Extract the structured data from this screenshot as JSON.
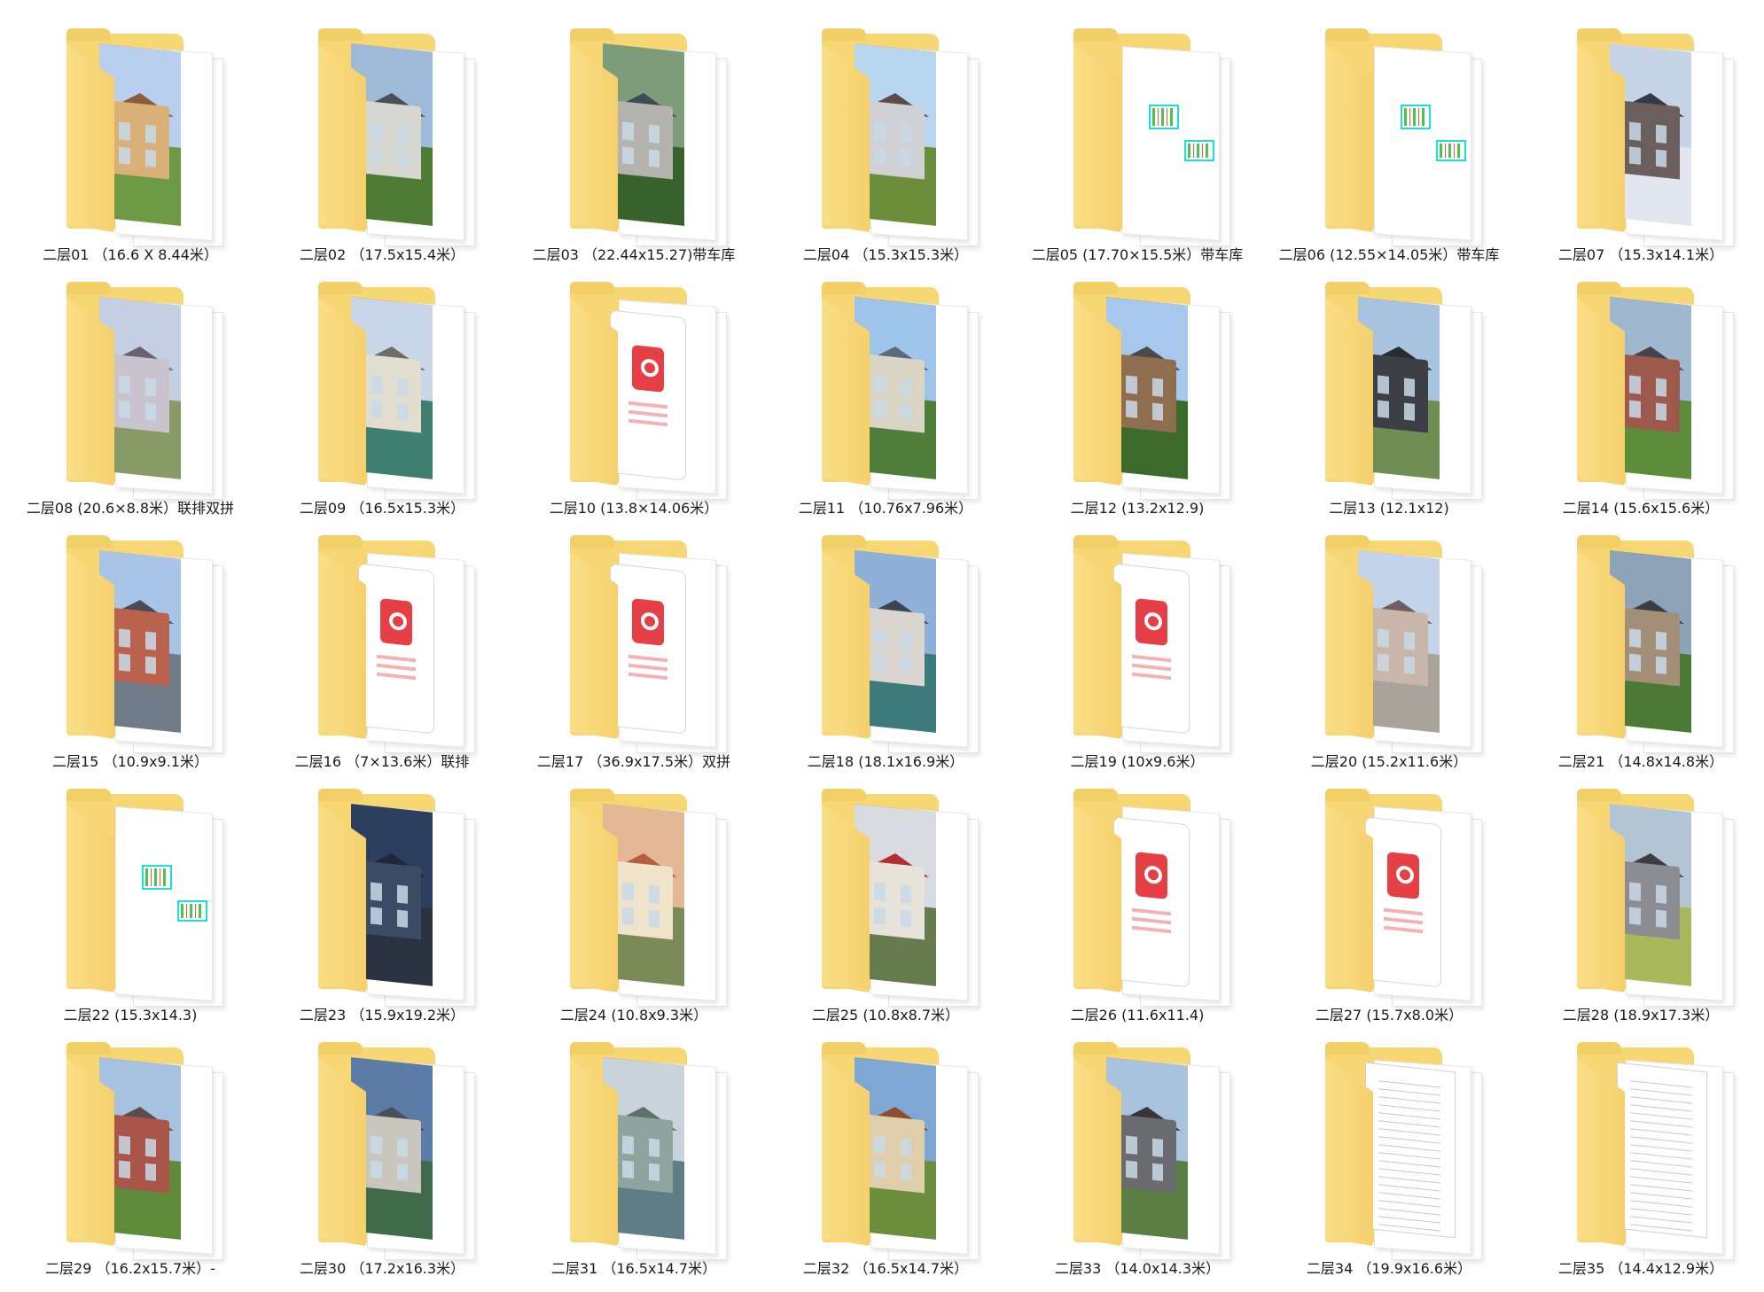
{
  "window": {
    "view": "large-icons"
  },
  "items": [
    {
      "label": "二层01 （16.6 X 8.44米）",
      "type": "photo",
      "sky": "#b9cff0",
      "house": "#d9b077",
      "roof": "#8a5a3a",
      "ground": "#6e9a45"
    },
    {
      "label": "二层02 （17.5x15.4米）",
      "type": "photo",
      "sky": "#9fb9d9",
      "house": "#d7d7d2",
      "roof": "#4c5056",
      "ground": "#4f7c34"
    },
    {
      "label": "二层03 （22.44x15.27)带车库",
      "type": "photo",
      "sky": "#7d9d7a",
      "house": "#b4b3ad",
      "roof": "#3f4c57",
      "ground": "#36632b"
    },
    {
      "label": "二层04 （15.3x15.3米）",
      "type": "photo",
      "sky": "#b9d6f0",
      "house": "#cfd1d4",
      "roof": "#5e4b47",
      "ground": "#6c8e3b"
    },
    {
      "label": "二层05 (17.70×15.5米）带车库",
      "type": "cad"
    },
    {
      "label": "二层06 (12.55×14.05米）带车库",
      "type": "cad"
    },
    {
      "label": "二层07 （15.3x14.1米）",
      "type": "photo",
      "sky": "#c7d3e6",
      "house": "#6a5f5c",
      "roof": "#353a44",
      "ground": "#e2e6ee"
    },
    {
      "label": "二层08 (20.6×8.8米）联排双拼",
      "type": "photo",
      "sky": "#c5cfe4",
      "house": "#c8c3cc",
      "roof": "#6c6171",
      "ground": "#889b66"
    },
    {
      "label": "二层09 （16.5x15.3米）",
      "type": "photo",
      "sky": "#c9d6ea",
      "house": "#e1ddcf",
      "roof": "#6e6e66",
      "ground": "#3f7f6f"
    },
    {
      "label": "二层10 (13.8×14.06米）",
      "type": "pdf"
    },
    {
      "label": "二层11 （10.76x7.96米）",
      "type": "photo",
      "sky": "#9fc4ea",
      "house": "#d9d4c3",
      "roof": "#5a6b7b",
      "ground": "#4f7d3a"
    },
    {
      "label": "二层12 (13.2x12.9)",
      "type": "photo",
      "sky": "#a7c7ec",
      "house": "#8f6e4f",
      "roof": "#4a4a4a",
      "ground": "#3c6a2a"
    },
    {
      "label": "二层13 (12.1x12)",
      "type": "photo",
      "sky": "#a8c3e0",
      "house": "#3d3f46",
      "roof": "#2a2c30",
      "ground": "#6e8e53"
    },
    {
      "label": "二层14 (15.6x15.6米）",
      "type": "photo",
      "sky": "#9fb8d0",
      "house": "#9d5a4c",
      "roof": "#44444a",
      "ground": "#5c8d3a"
    },
    {
      "label": "二层15 （10.9x9.1米）",
      "type": "photo",
      "sky": "#a8c4e6",
      "house": "#b9634f",
      "roof": "#4a4c55",
      "ground": "#6f7c88"
    },
    {
      "label": "二层16 （7×13.6米）联排",
      "type": "pdf"
    },
    {
      "label": "二层17 （36.9x17.5米）双拼",
      "type": "pdf"
    },
    {
      "label": "二层18 (18.1x16.9米）",
      "type": "photo",
      "sky": "#8fb0d8",
      "house": "#dad6cf",
      "roof": "#3e4351",
      "ground": "#3d7a7c"
    },
    {
      "label": "二层19 (10x9.6米）",
      "type": "pdf"
    },
    {
      "label": "二层20 (15.2x11.6米）",
      "type": "photo",
      "sky": "#c3d3ea",
      "house": "#c7b6a9",
      "roof": "#6f5e61",
      "ground": "#a9a39b"
    },
    {
      "label": "二层21 （14.8x14.8米）",
      "type": "photo",
      "sky": "#8da3b7",
      "house": "#a38f77",
      "roof": "#3d3e42",
      "ground": "#4c7a35"
    },
    {
      "label": "二层22 (15.3x14.3)",
      "type": "cad"
    },
    {
      "label": "二层23 （15.9x19.2米）",
      "type": "photo",
      "sky": "#2c3f5e",
      "house": "#3b4b63",
      "roof": "#1f2838",
      "ground": "#2a3342"
    },
    {
      "label": "二层24 (10.8x9.3米）",
      "type": "photo",
      "sky": "#e2b994",
      "house": "#efe3c9",
      "roof": "#b55f3e",
      "ground": "#7a8a59"
    },
    {
      "label": "二层25 (10.8x8.7米）",
      "type": "photo",
      "sky": "#d8dbe0",
      "house": "#e8e3da",
      "roof": "#b32e2f",
      "ground": "#667b4e"
    },
    {
      "label": "二层26 (11.6x11.4)",
      "type": "pdf"
    },
    {
      "label": "二层27 (15.7x8.0米）",
      "type": "pdf"
    },
    {
      "label": "二层28 (18.9x17.3米）",
      "type": "photo",
      "sky": "#b3c4d4",
      "house": "#8b8d93",
      "roof": "#3b3d43",
      "ground": "#a9b85a"
    },
    {
      "label": "二层29 （16.2x15.7米）-",
      "type": "photo",
      "sky": "#a7c2e1",
      "house": "#a9554a",
      "roof": "#5a4d4a",
      "ground": "#5f8a3a"
    },
    {
      "label": "二层30 （17.2x16.3米）",
      "type": "photo",
      "sky": "#5c7ca8",
      "house": "#c9c6be",
      "roof": "#4b4f5b",
      "ground": "#3f6b4a"
    },
    {
      "label": "二层31 （16.5x14.7米）",
      "type": "photo",
      "sky": "#c9d3dc",
      "house": "#8ea59f",
      "roof": "#5f6f6a",
      "ground": "#5f7d84"
    },
    {
      "label": "二层32 （16.5x14.7米）",
      "type": "photo",
      "sky": "#7fa7d4",
      "house": "#e0cda9",
      "roof": "#8f4c35",
      "ground": "#6b8e3c"
    },
    {
      "label": "二层33 （14.0x14.3米）",
      "type": "photo",
      "sky": "#a9c2dd",
      "house": "#6a6b6f",
      "roof": "#343639",
      "ground": "#5b7e44"
    },
    {
      "label": "二层34 （19.9x16.6米）",
      "type": "doc"
    },
    {
      "label": "二层35 （14.4x12.9米）",
      "type": "doc"
    }
  ]
}
